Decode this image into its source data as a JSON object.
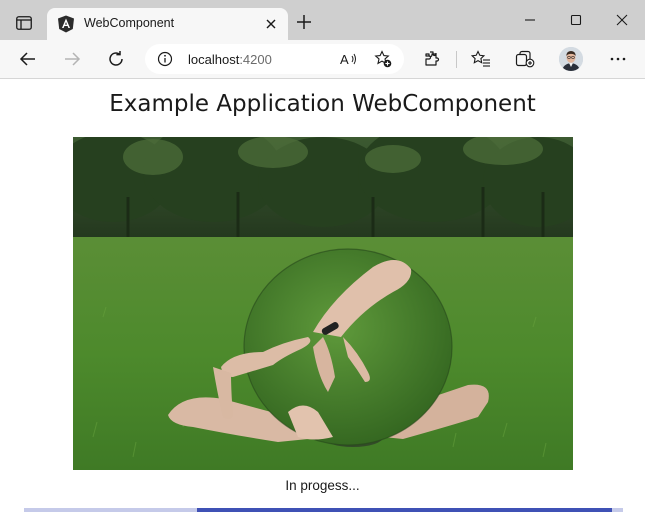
{
  "browser": {
    "tab": {
      "title": "WebComponent"
    },
    "address": {
      "host": "localhost",
      "port": ":4200"
    }
  },
  "page": {
    "title": "Example Application WebComponent",
    "status": "In progess...",
    "progress_percent": 70
  },
  "colors": {
    "progress_track": "#c5cae9",
    "progress_fill": "#3f51b5"
  },
  "icons": [
    "tab-actions-icon",
    "angular-favicon",
    "close-icon",
    "plus-icon",
    "minimize-icon",
    "maximize-icon",
    "window-close-icon",
    "back-icon",
    "forward-icon",
    "refresh-icon",
    "info-icon",
    "read-aloud-icon",
    "add-favorite-icon",
    "extensions-icon",
    "favorites-icon",
    "collections-icon",
    "more-icon"
  ]
}
